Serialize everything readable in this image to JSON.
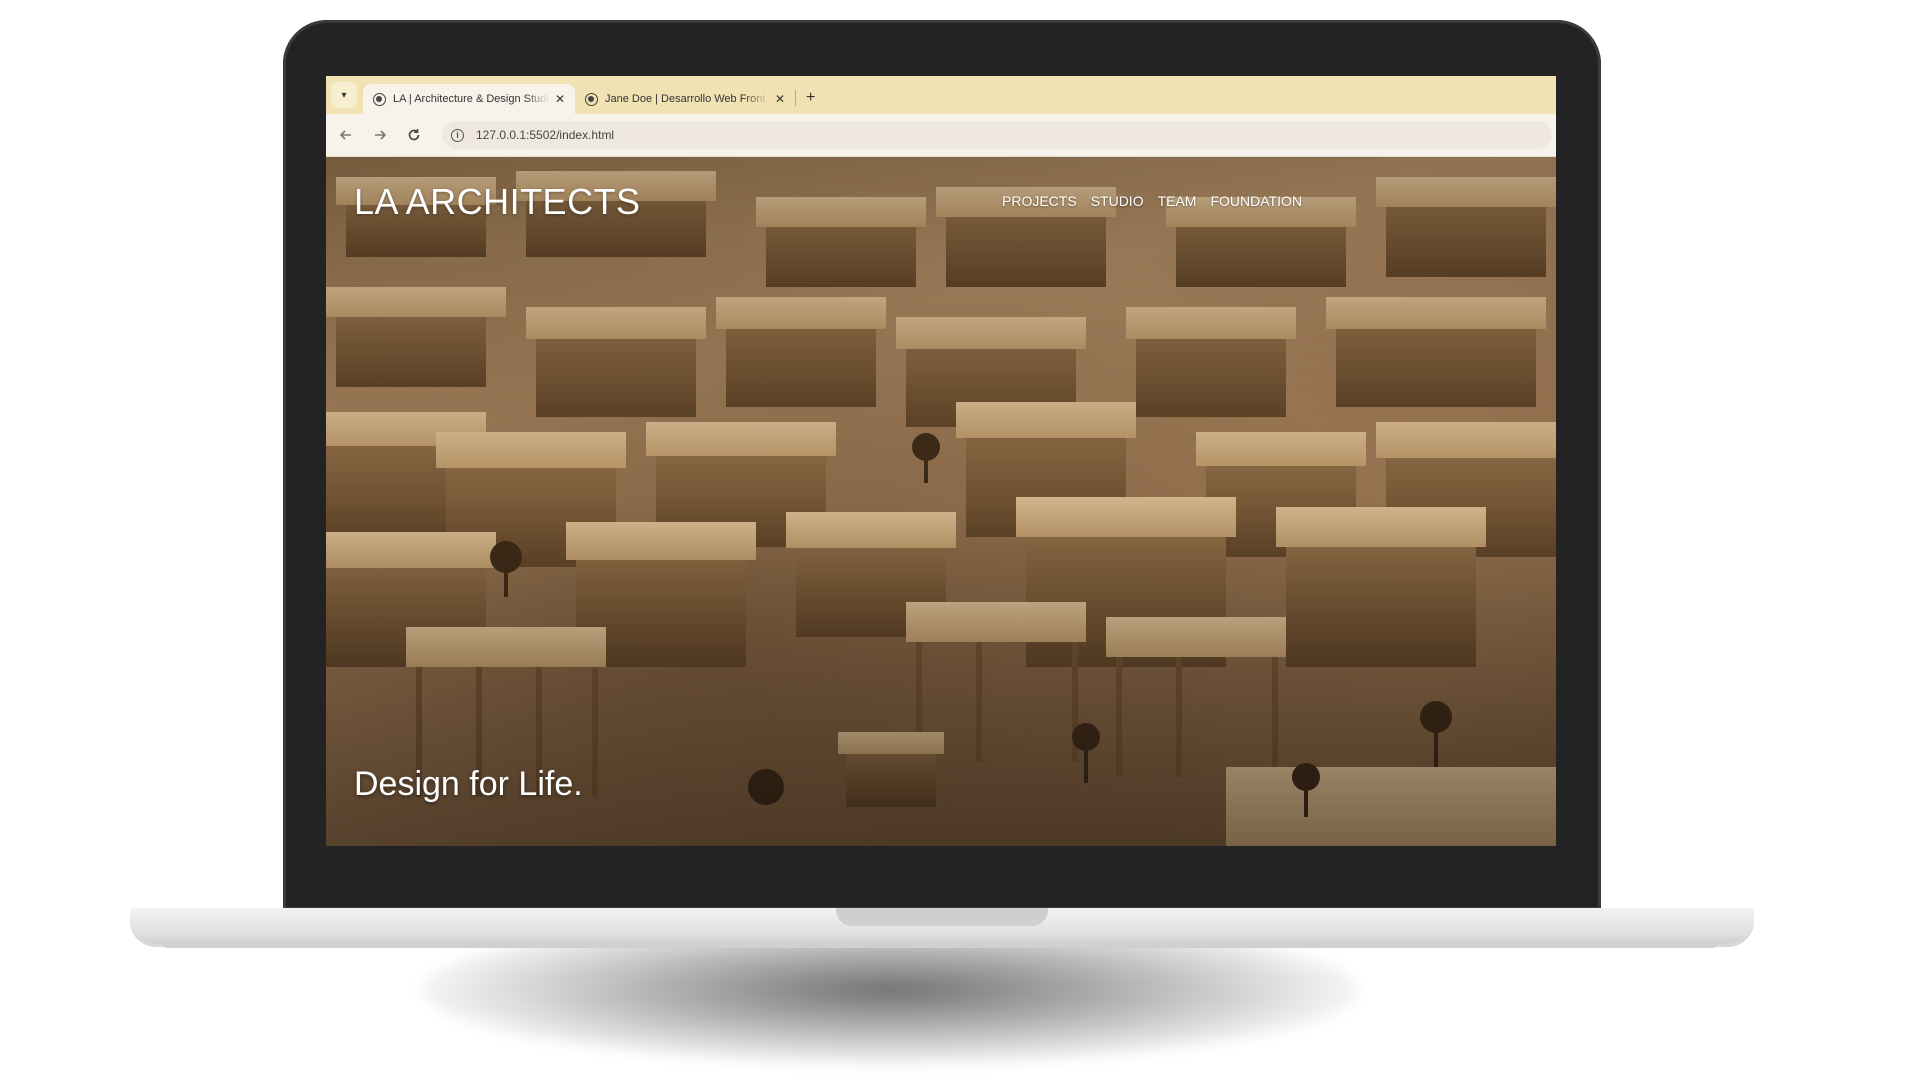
{
  "browser": {
    "tabs": [
      {
        "title": "LA | Architecture & Design Studio",
        "active": true
      },
      {
        "title": "Jane Doe | Desarrollo Web Front",
        "active": false
      }
    ],
    "tab_menu_icon": "chevron-down-icon",
    "close_glyph": "✕",
    "new_tab_glyph": "+",
    "address": "127.0.0.1:5502/index.html",
    "nav_icons": [
      "back-arrow-icon",
      "forward-arrow-icon",
      "reload-icon",
      "info-icon"
    ]
  },
  "site": {
    "logo": "LA ARCHITECTS",
    "nav": [
      "PROJECTS",
      "STUDIO",
      "TEAM",
      "FOUNDATION"
    ],
    "tagline": "Design for Life."
  },
  "colors": {
    "tabbar": "#f0e2b3",
    "toolbar": "#f7f3ea",
    "laptop_bezel": "#232323",
    "hero_tone": "#a98660"
  }
}
